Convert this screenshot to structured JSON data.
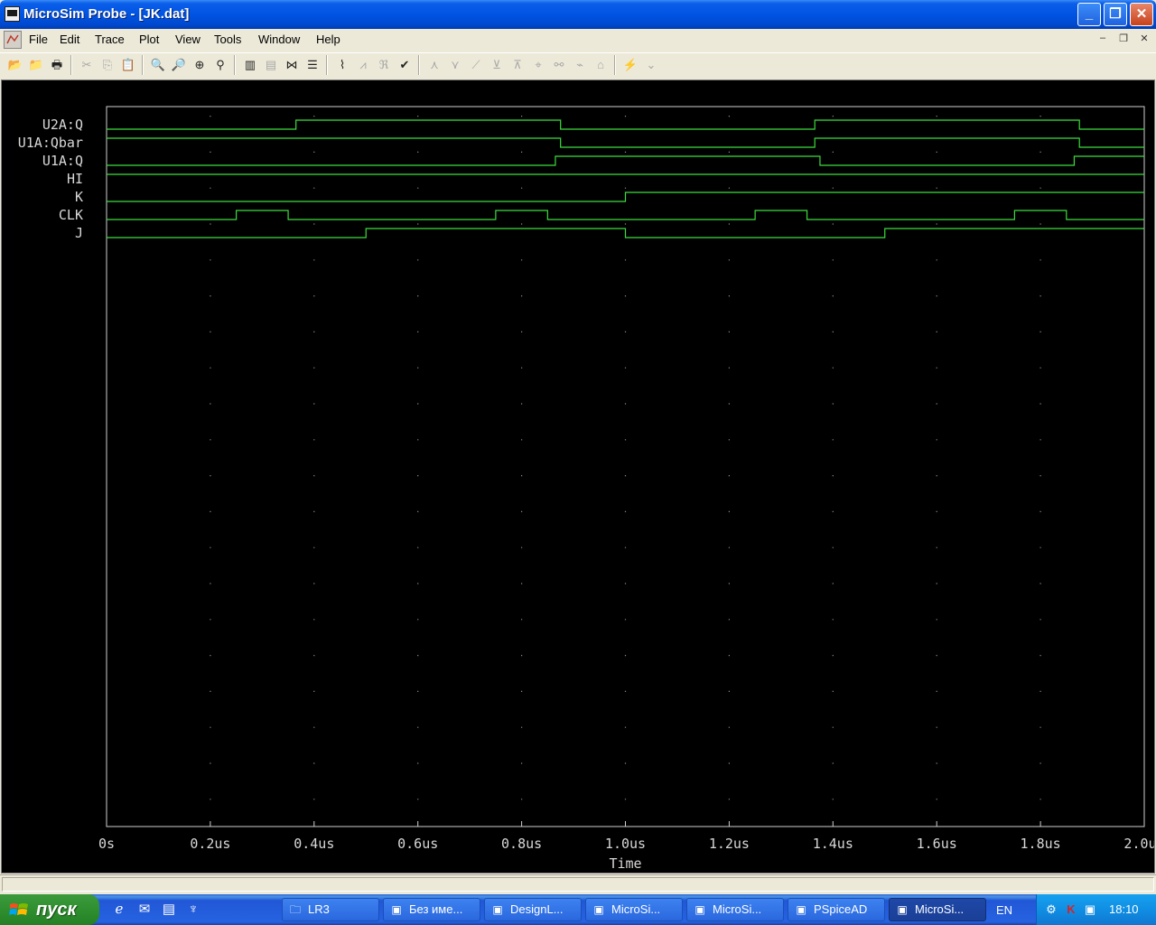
{
  "window": {
    "title": "MicroSim Probe - [JK.dat]",
    "controls": {
      "minimize": "_",
      "maximize": "❐",
      "close": "✕"
    }
  },
  "menu": [
    "File",
    "Edit",
    "Trace",
    "Plot",
    "View",
    "Tools",
    "Window",
    "Help"
  ],
  "mdi_controls": {
    "minimize": "–",
    "restore": "❐",
    "close": "✕"
  },
  "toolbar": [
    {
      "name": "open-icon",
      "glyph": "📂",
      "enabled": true
    },
    {
      "name": "append-icon",
      "glyph": "📁",
      "enabled": true
    },
    {
      "name": "print-icon",
      "glyph": "🖶",
      "enabled": true
    },
    {
      "name": "cut-icon",
      "glyph": "✂",
      "enabled": false
    },
    {
      "name": "copy-icon",
      "glyph": "⎘",
      "enabled": false
    },
    {
      "name": "paste-icon",
      "glyph": "📋",
      "enabled": false
    },
    {
      "name": "zoom-in-icon",
      "glyph": "🔍",
      "enabled": true
    },
    {
      "name": "zoom-out-icon",
      "glyph": "🔎",
      "enabled": true
    },
    {
      "name": "zoom-area-icon",
      "glyph": "⊕",
      "enabled": true
    },
    {
      "name": "zoom-fit-icon",
      "glyph": "⚲",
      "enabled": true
    },
    {
      "name": "log-x-icon",
      "glyph": "▥",
      "enabled": true
    },
    {
      "name": "fourier-icon",
      "glyph": "▤",
      "enabled": false
    },
    {
      "name": "performance-icon",
      "glyph": "⋈",
      "enabled": true
    },
    {
      "name": "add-trace-icon",
      "glyph": "☰",
      "enabled": true
    },
    {
      "name": "eval-goal-icon",
      "glyph": "⌇",
      "enabled": true
    },
    {
      "name": "mark-data-icon",
      "glyph": "⩘",
      "enabled": false
    },
    {
      "name": "mark-label-icon",
      "glyph": "ℜ",
      "enabled": false
    },
    {
      "name": "toggle-cursor-icon",
      "glyph": "✔",
      "enabled": true
    },
    {
      "name": "cursor-peak-icon",
      "glyph": "⋏",
      "enabled": false
    },
    {
      "name": "cursor-trough-icon",
      "glyph": "⋎",
      "enabled": false
    },
    {
      "name": "cursor-slope-icon",
      "glyph": "⟋",
      "enabled": false
    },
    {
      "name": "cursor-min-icon",
      "glyph": "⊻",
      "enabled": false
    },
    {
      "name": "cursor-max-icon",
      "glyph": "⊼",
      "enabled": false
    },
    {
      "name": "cursor-point-icon",
      "glyph": "⌖",
      "enabled": false
    },
    {
      "name": "cursor-search-icon",
      "glyph": "⚯",
      "enabled": false
    },
    {
      "name": "cursor-next-tran-icon",
      "glyph": "⌁",
      "enabled": false
    },
    {
      "name": "cursor-prev-tran-icon",
      "glyph": "⌂",
      "enabled": false
    },
    {
      "name": "mark-label-2-icon",
      "glyph": "⚡",
      "enabled": false
    },
    {
      "name": "cursor-label-icon",
      "glyph": "⌄",
      "enabled": false
    }
  ],
  "chart_data": {
    "type": "line",
    "title": "",
    "xlabel": "Time",
    "xlim": [
      0,
      2.0
    ],
    "x_unit": "us",
    "x_ticks": [
      "0s",
      "0.2us",
      "0.4us",
      "0.6us",
      "0.8us",
      "1.0us",
      "1.2us",
      "1.4us",
      "1.6us",
      "1.8us",
      "2.0us"
    ],
    "grid": true,
    "series": [
      {
        "name": "U2A:Q",
        "initial": 0,
        "transitions": [
          0.365,
          0.875,
          1.365,
          1.875
        ]
      },
      {
        "name": "U1A:Qbar",
        "initial": 1,
        "transitions": [
          0.875,
          1.365,
          1.875
        ]
      },
      {
        "name": "U1A:Q",
        "initial": 0,
        "transitions": [
          0.865,
          1.375,
          1.865
        ]
      },
      {
        "name": "HI",
        "initial": 1,
        "transitions": []
      },
      {
        "name": "K",
        "initial": 0,
        "transitions": [
          1.0
        ]
      },
      {
        "name": "CLK",
        "initial": 0,
        "transitions": [
          0.25,
          0.35,
          0.75,
          0.85,
          1.25,
          1.35,
          1.75,
          1.85
        ]
      },
      {
        "name": "J",
        "initial": 0,
        "transitions": [
          0.5,
          1.0,
          1.5
        ]
      }
    ],
    "colors": {
      "trace": "#3cdc3c",
      "background": "#000000",
      "frame": "#cfcfcf",
      "grid": "#8a8a8a",
      "text": "#d8d8d8"
    }
  },
  "taskbar": {
    "start": "пуск",
    "quick_launch": [
      "ie-icon",
      "outlook-icon",
      "notepad-icon",
      "app-icon"
    ],
    "tasks": [
      {
        "label": "LR3",
        "icon": "folder-icon",
        "active": false
      },
      {
        "label": "Без име...",
        "icon": "paint-icon",
        "active": false
      },
      {
        "label": "DesignL...",
        "icon": "designlab-icon",
        "active": false
      },
      {
        "label": "MicroSi...",
        "icon": "microsim-icon",
        "active": false
      },
      {
        "label": "MicroSi...",
        "icon": "microsim-edit-icon",
        "active": false
      },
      {
        "label": "PSpiceAD",
        "icon": "pspice-icon",
        "active": false
      },
      {
        "label": "MicroSi...",
        "icon": "probe-icon",
        "active": true
      }
    ],
    "language": "EN",
    "clock": "18:10"
  }
}
